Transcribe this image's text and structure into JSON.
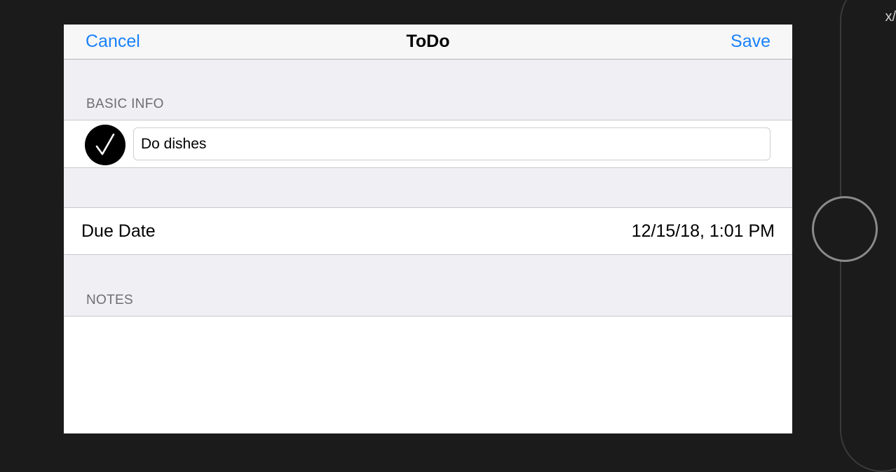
{
  "device": {
    "corner_glyph": "x/"
  },
  "navbar": {
    "cancel_label": "Cancel",
    "title": "ToDo",
    "save_label": "Save"
  },
  "basic_info": {
    "header": "BASIC INFO",
    "completed": true,
    "check_icon": "checkmark-icon",
    "title_value": "Do dishes"
  },
  "due_date": {
    "label": "Due Date",
    "value": "12/15/18, 1:01 PM"
  },
  "notes": {
    "header": "NOTES",
    "value": ""
  },
  "colors": {
    "accent": "#1a82fb",
    "background": "#efeff4",
    "device": "#1b1b1b"
  }
}
